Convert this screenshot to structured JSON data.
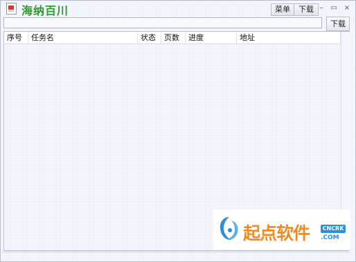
{
  "app": {
    "title": "海纳百川",
    "icon": "app-document-icon"
  },
  "titlebar": {
    "menu_label": "菜单",
    "download_label": "下载",
    "minimize": "–",
    "maximize": "▭",
    "close": "×"
  },
  "urlbar": {
    "value": "",
    "placeholder": "",
    "download_button": "下载"
  },
  "list": {
    "columns": [
      "序号",
      "任务名",
      "状态",
      "页数",
      "进度",
      "地址"
    ],
    "rows": []
  },
  "watermark": {
    "text": "起点软件",
    "badge": "CNCRK",
    "domain": ".COM",
    "icon": "cncrk-logo-icon"
  },
  "colors": {
    "title_green": "#2d9a2d",
    "logo_orange": "#f28a1e",
    "logo_blue": "#2d8fd8"
  }
}
